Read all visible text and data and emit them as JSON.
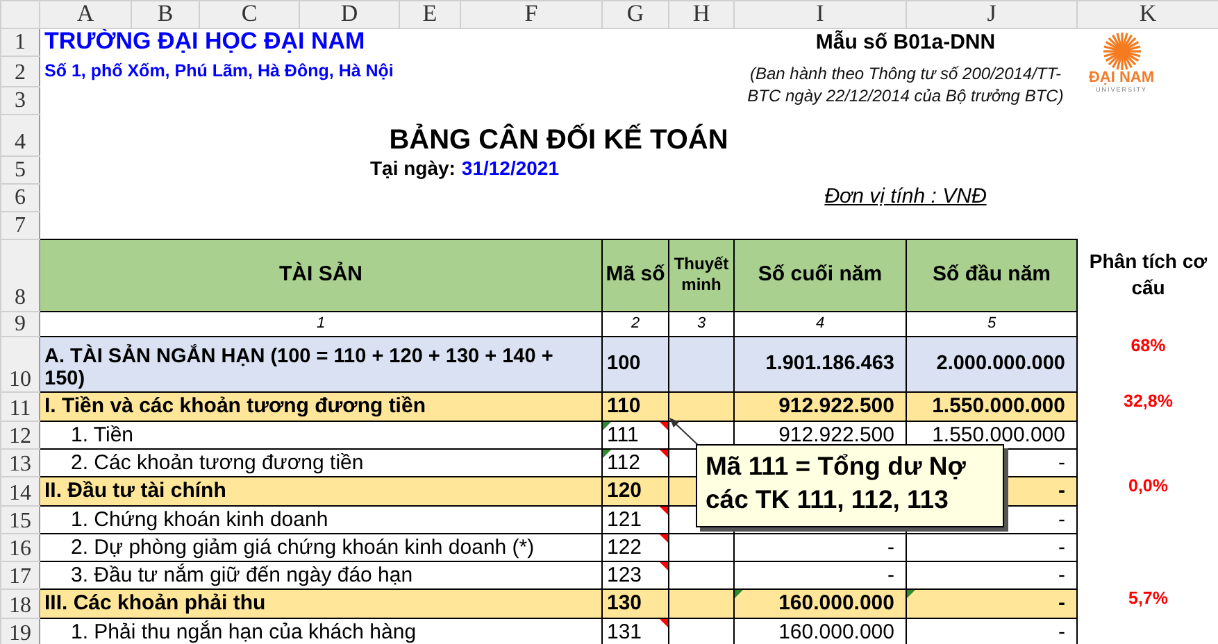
{
  "column_headers": [
    "A",
    "B",
    "C",
    "D",
    "E",
    "F",
    "G",
    "H",
    "I",
    "J",
    "K"
  ],
  "row_numbers": [
    "1",
    "2",
    "3",
    "4",
    "5",
    "6",
    "7",
    "8",
    "9",
    "10",
    "11",
    "12",
    "13",
    "14",
    "15",
    "16",
    "17",
    "18",
    "19"
  ],
  "school": {
    "name": "TRƯỜNG ĐẠI HỌC ĐẠI NAM",
    "address": "Số 1, phố Xốm, Phú Lãm, Hà Đông, Hà Nội"
  },
  "form": {
    "number": "Mẫu số B01a-DNN",
    "issuance": "(Ban hành theo Thông tư số 200/2014/TT-BTC ngày 22/12/2014 của Bộ trưởng BTC)"
  },
  "logo": {
    "name": "ĐẠI NAM",
    "tagline": "UNIVERSITY"
  },
  "title": "BẢNG CÂN ĐỐI KẾ TOÁN",
  "date": {
    "label": "Tại ngày:",
    "value": "31/12/2021"
  },
  "unit": "Đơn vị tính : VNĐ",
  "table": {
    "columns": [
      "TÀI SẢN",
      "Mã số",
      "Thuyết minh",
      "Số cuối năm",
      "Số đầu năm"
    ],
    "column_numbers": [
      "1",
      "2",
      "3",
      "4",
      "5"
    ],
    "analysis_header": "Phân tích cơ cấu",
    "rows": [
      {
        "kind": "total",
        "label": "A. TÀI SẢN NGẮN HẠN (100 = 110 + 120 + 130 + 140 + 150)",
        "code": "100",
        "end": "1.901.186.463",
        "start": "2.000.000.000",
        "ratio": "68%",
        "code_comment": false,
        "code_warning": false,
        "end_warning": false,
        "start_warning": false
      },
      {
        "kind": "section",
        "label": "I. Tiền và các khoản tương đương tiền",
        "code": "110",
        "end": "912.922.500",
        "start": "1.550.000.000",
        "ratio": "32,8%",
        "code_comment": false,
        "code_warning": false,
        "end_warning": false,
        "start_warning": false
      },
      {
        "kind": "item",
        "label": "1. Tiền",
        "code": "111",
        "end": "912.922.500",
        "start": "1.550.000.000",
        "code_comment": true,
        "code_warning": true,
        "end_warning": false,
        "start_warning": false
      },
      {
        "kind": "item",
        "label": "2. Các khoản tương đương tiền",
        "code": "112",
        "start": "-",
        "code_comment": true,
        "code_warning": true,
        "end_warning": false,
        "start_warning": false
      },
      {
        "kind": "section",
        "label": "II. Đầu tư tài chính",
        "code": "120",
        "start": "-",
        "ratio": "0,0%",
        "code_comment": false,
        "code_warning": false,
        "end_warning": false,
        "start_warning": false
      },
      {
        "kind": "item",
        "label": "1. Chứng khoán kinh doanh",
        "code": "121",
        "start": "-",
        "code_comment": true,
        "code_warning": false,
        "end_warning": false,
        "start_warning": false
      },
      {
        "kind": "item",
        "label": "2. Dự phòng giảm giá chứng khoán kinh doanh (*)",
        "code": "122",
        "end": "-",
        "start": "-",
        "code_comment": true,
        "code_warning": false,
        "end_warning": false,
        "start_warning": false
      },
      {
        "kind": "item",
        "label": "3. Đầu tư nắm giữ đến ngày đáo hạn",
        "code": "123",
        "end": "-",
        "start": "-",
        "code_comment": true,
        "code_warning": false,
        "end_warning": false,
        "start_warning": false
      },
      {
        "kind": "section",
        "label": "III. Các khoản phải thu",
        "code": "130",
        "end": "160.000.000",
        "start": "-",
        "ratio": "5,7%",
        "code_comment": false,
        "code_warning": false,
        "end_warning": true,
        "start_warning": true
      },
      {
        "kind": "item",
        "label": "1. Phải thu ngắn hạn của khách hàng",
        "code": "131",
        "end": "160.000.000",
        "start": "-",
        "code_comment": true,
        "code_warning": false,
        "end_warning": false,
        "start_warning": false
      }
    ]
  },
  "comment": {
    "text": "Mã 111 = Tổng dư Nợ các TK 111, 112, 113"
  }
}
